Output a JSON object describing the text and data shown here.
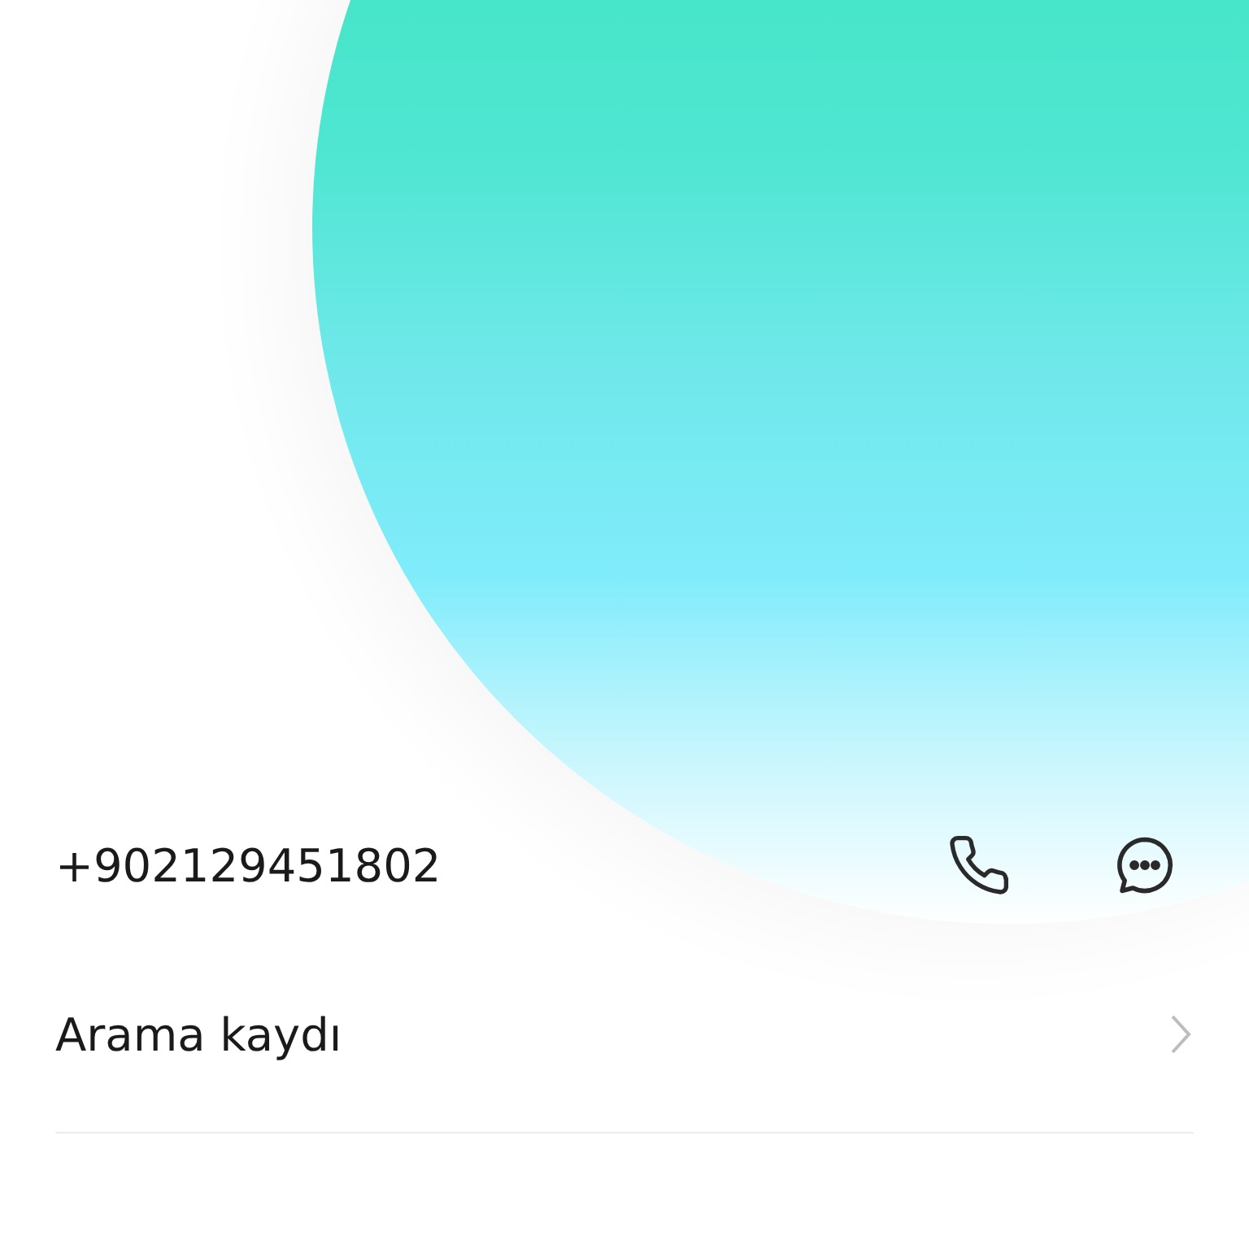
{
  "contact": {
    "number": "+902129451802"
  },
  "rows": [
    {
      "label": "Arama kaydı"
    }
  ]
}
